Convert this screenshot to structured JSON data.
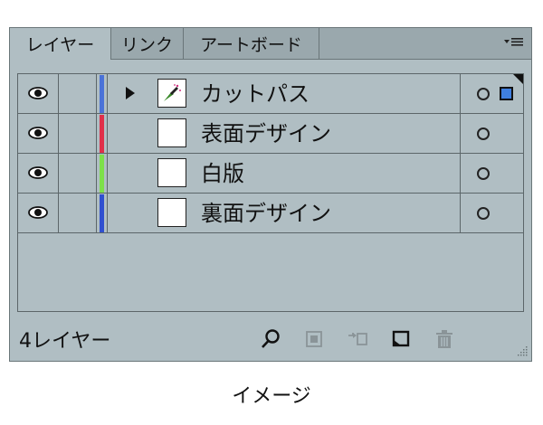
{
  "tabs": [
    {
      "label": "レイヤー",
      "active": true
    },
    {
      "label": "リンク",
      "active": false
    },
    {
      "label": "アートボード",
      "active": false
    }
  ],
  "panel_menu_icon": "panel-menu-icon",
  "layers": [
    {
      "name": "カットパス",
      "color": "#4a72d8",
      "expandable": true,
      "selected": true
    },
    {
      "name": "表面デザイン",
      "color": "#e0304a",
      "expandable": false,
      "selected": false
    },
    {
      "name": "白版",
      "color": "#7de04a",
      "expandable": false,
      "selected": false
    },
    {
      "name": "裏面デザイン",
      "color": "#3050d0",
      "expandable": false,
      "selected": false
    }
  ],
  "footer": {
    "count_label": "4レイヤー",
    "icons": [
      "search-icon",
      "clipping-mask-icon",
      "move-to-layer-icon",
      "new-layer-icon",
      "delete-icon"
    ]
  },
  "caption": "イメージ"
}
